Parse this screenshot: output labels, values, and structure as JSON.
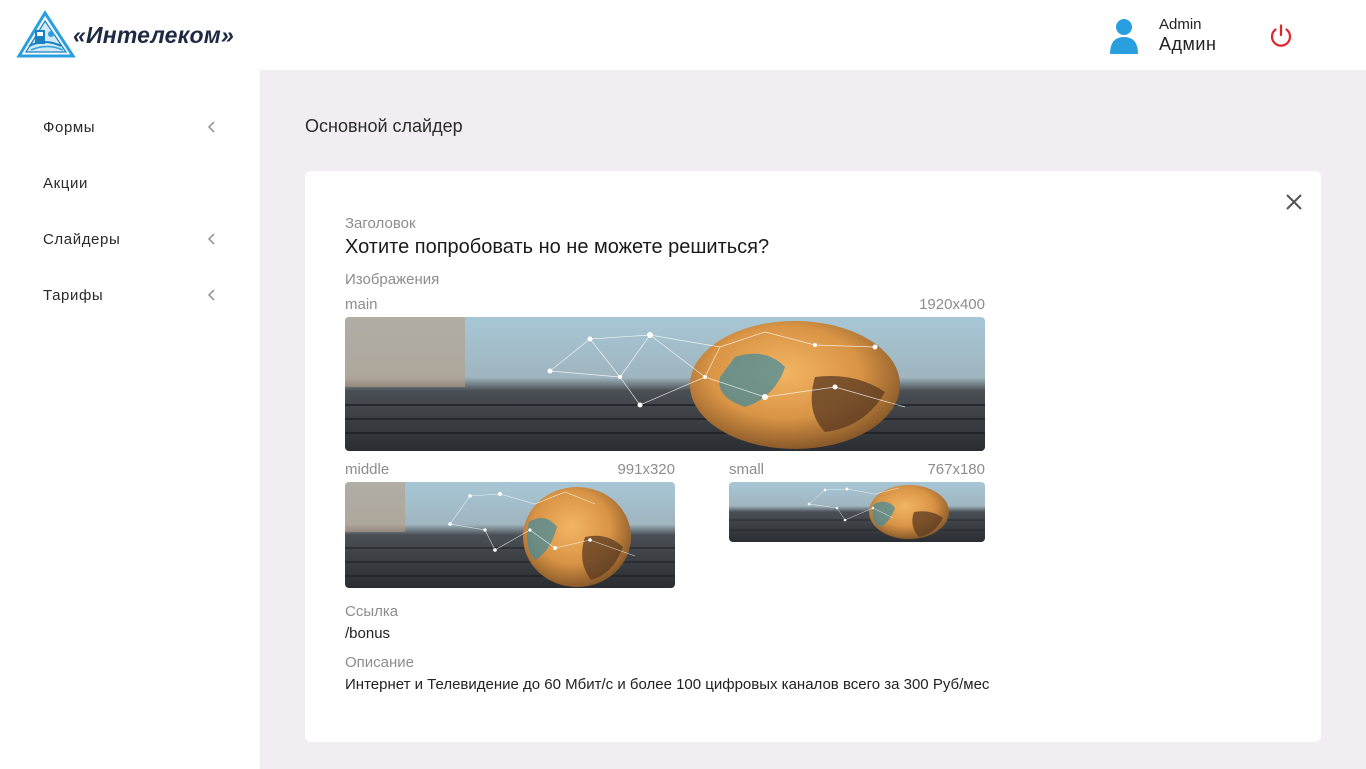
{
  "brand": {
    "logo_text": "«Интелеком»"
  },
  "user": {
    "role": "Admin",
    "name": "Админ"
  },
  "sidebar": {
    "items": [
      {
        "label": "Формы",
        "has_submenu": true
      },
      {
        "label": "Акции",
        "has_submenu": false
      },
      {
        "label": "Слайдеры",
        "has_submenu": true
      },
      {
        "label": "Тарифы",
        "has_submenu": true
      }
    ]
  },
  "page": {
    "title": "Основной слайдер"
  },
  "slide": {
    "heading_label": "Заголовок",
    "heading": "Хотите попробовать но не можете решиться?",
    "images_label": "Изображения",
    "images": [
      {
        "name": "main",
        "size": "1920x400"
      },
      {
        "name": "middle",
        "size": "991x320"
      },
      {
        "name": "small",
        "size": "767x180"
      }
    ],
    "link_label": "Ссылка",
    "link": "/bonus",
    "description_label": "Описание",
    "description": "Интернет и Телевидение до 60 Мбит/с и более 100 цифровых каналов всего за 300 Руб/мес"
  },
  "colors": {
    "content_bg": "#f1edf2",
    "accent_blue": "#2a9fe0",
    "power_red": "#e0262a"
  },
  "icons": {
    "logo": "intelecom-logo-icon",
    "user": "user-avatar-icon",
    "power": "power-icon",
    "chevron": "chevron-left-icon",
    "close": "close-icon"
  }
}
